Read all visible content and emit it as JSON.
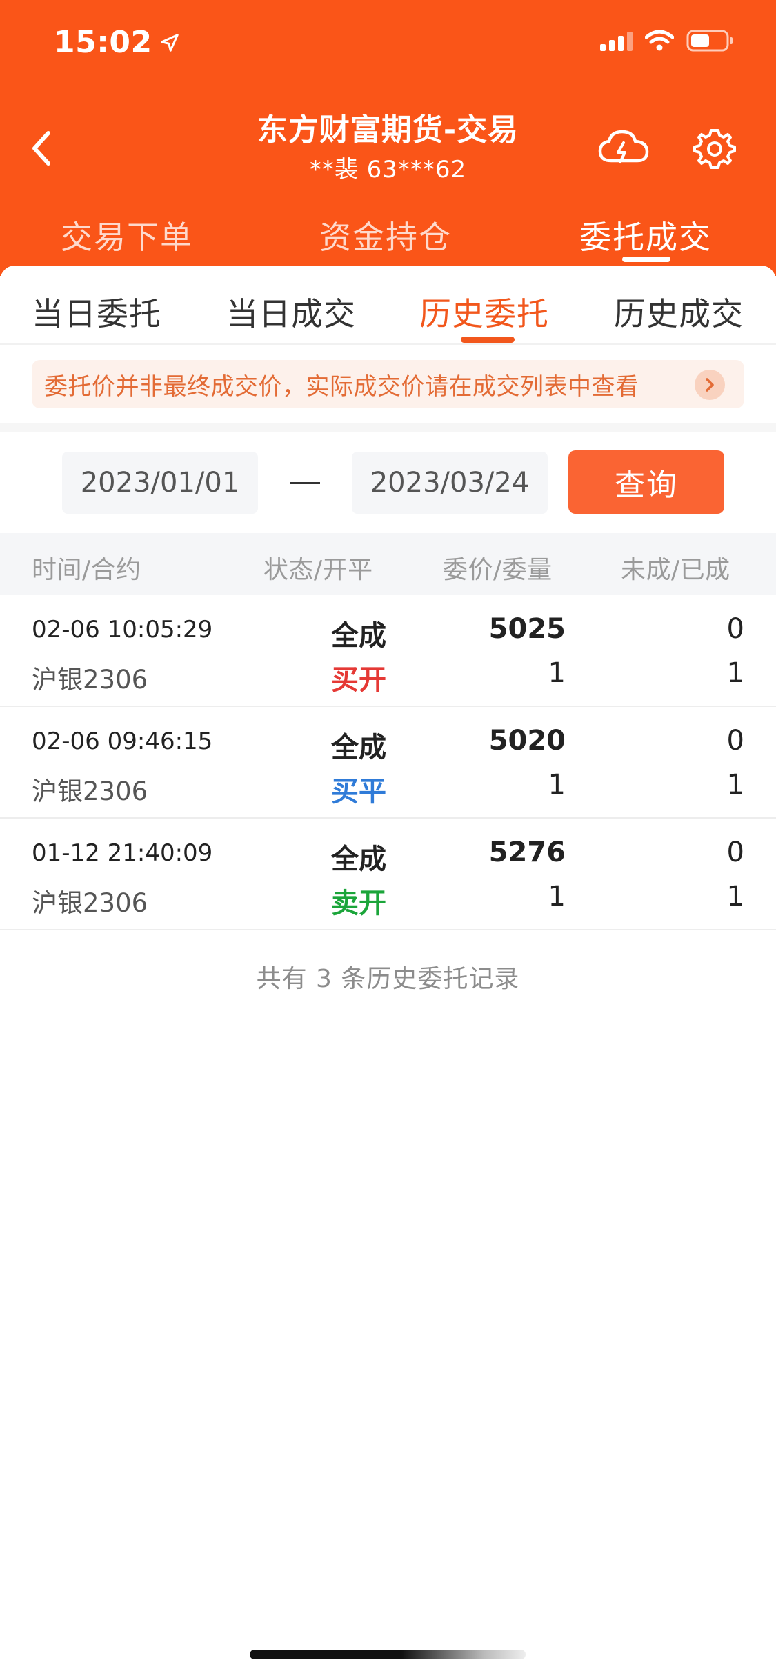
{
  "status_bar": {
    "time": "15:02",
    "icons": [
      "location-arrow-icon",
      "signal-icon",
      "wifi-icon",
      "battery-icon"
    ]
  },
  "nav": {
    "title": "东方财富期货-交易",
    "subtitle": "**裴 63***62",
    "icons": [
      "back-arrow-icon",
      "cloud-icon",
      "gear-icon"
    ]
  },
  "top_tabs": [
    {
      "label": "交易下单",
      "active": false
    },
    {
      "label": "资金持仓",
      "active": false
    },
    {
      "label": "委托成交",
      "active": true
    }
  ],
  "sub_tabs": [
    {
      "label": "当日委托",
      "active": false
    },
    {
      "label": "当日成交",
      "active": false
    },
    {
      "label": "历史委托",
      "active": true
    },
    {
      "label": "历史成交",
      "active": false
    }
  ],
  "notice": {
    "text": "委托价并非最终成交价，实际成交价请在成交列表中查看"
  },
  "query": {
    "start_date": "2023/01/01",
    "end_date": "2023/03/24",
    "button": "查询"
  },
  "table": {
    "headers": [
      "时间/合约",
      "状态/开平",
      "委价/委量",
      "未成/已成"
    ],
    "rows": [
      {
        "time": "02-06 10:05:29",
        "contract": "沪银2306",
        "status": "全成",
        "side": "买开",
        "side_color": "#E53935",
        "price": "5025",
        "qty": "1",
        "unfilled": "0",
        "filled": "1"
      },
      {
        "time": "02-06 09:46:15",
        "contract": "沪银2306",
        "status": "全成",
        "side": "买平",
        "side_color": "#2F7BD8",
        "price": "5020",
        "qty": "1",
        "unfilled": "0",
        "filled": "1"
      },
      {
        "time": "01-12 21:40:09",
        "contract": "沪银2306",
        "status": "全成",
        "side": "卖开",
        "side_color": "#1BA53A",
        "price": "5276",
        "qty": "1",
        "unfilled": "0",
        "filled": "1"
      }
    ]
  },
  "summary": "共有 3 条历史委托记录",
  "colors": {
    "brand": "#FA5518",
    "accent": "#F2571C",
    "button": "#FA6433"
  }
}
